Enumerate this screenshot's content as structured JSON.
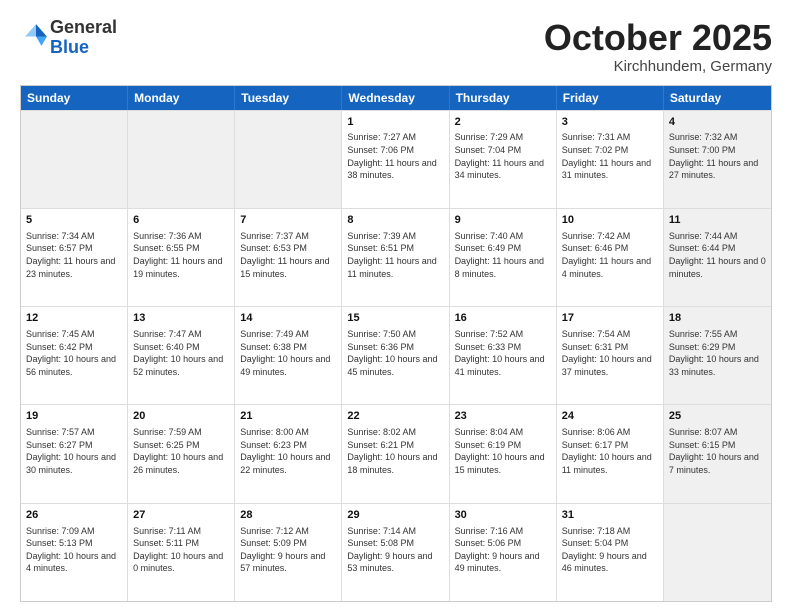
{
  "header": {
    "logo_general": "General",
    "logo_blue": "Blue",
    "title": "October 2025",
    "location": "Kirchhundem, Germany"
  },
  "days": [
    "Sunday",
    "Monday",
    "Tuesday",
    "Wednesday",
    "Thursday",
    "Friday",
    "Saturday"
  ],
  "weeks": [
    [
      {
        "day": "",
        "info": "",
        "shaded": true
      },
      {
        "day": "",
        "info": "",
        "shaded": true
      },
      {
        "day": "",
        "info": "",
        "shaded": true
      },
      {
        "day": "1",
        "info": "Sunrise: 7:27 AM\nSunset: 7:06 PM\nDaylight: 11 hours and 38 minutes."
      },
      {
        "day": "2",
        "info": "Sunrise: 7:29 AM\nSunset: 7:04 PM\nDaylight: 11 hours and 34 minutes."
      },
      {
        "day": "3",
        "info": "Sunrise: 7:31 AM\nSunset: 7:02 PM\nDaylight: 11 hours and 31 minutes."
      },
      {
        "day": "4",
        "info": "Sunrise: 7:32 AM\nSunset: 7:00 PM\nDaylight: 11 hours and 27 minutes.",
        "shaded": true
      }
    ],
    [
      {
        "day": "5",
        "info": "Sunrise: 7:34 AM\nSunset: 6:57 PM\nDaylight: 11 hours and 23 minutes."
      },
      {
        "day": "6",
        "info": "Sunrise: 7:36 AM\nSunset: 6:55 PM\nDaylight: 11 hours and 19 minutes."
      },
      {
        "day": "7",
        "info": "Sunrise: 7:37 AM\nSunset: 6:53 PM\nDaylight: 11 hours and 15 minutes."
      },
      {
        "day": "8",
        "info": "Sunrise: 7:39 AM\nSunset: 6:51 PM\nDaylight: 11 hours and 11 minutes."
      },
      {
        "day": "9",
        "info": "Sunrise: 7:40 AM\nSunset: 6:49 PM\nDaylight: 11 hours and 8 minutes."
      },
      {
        "day": "10",
        "info": "Sunrise: 7:42 AM\nSunset: 6:46 PM\nDaylight: 11 hours and 4 minutes."
      },
      {
        "day": "11",
        "info": "Sunrise: 7:44 AM\nSunset: 6:44 PM\nDaylight: 11 hours and 0 minutes.",
        "shaded": true
      }
    ],
    [
      {
        "day": "12",
        "info": "Sunrise: 7:45 AM\nSunset: 6:42 PM\nDaylight: 10 hours and 56 minutes."
      },
      {
        "day": "13",
        "info": "Sunrise: 7:47 AM\nSunset: 6:40 PM\nDaylight: 10 hours and 52 minutes."
      },
      {
        "day": "14",
        "info": "Sunrise: 7:49 AM\nSunset: 6:38 PM\nDaylight: 10 hours and 49 minutes."
      },
      {
        "day": "15",
        "info": "Sunrise: 7:50 AM\nSunset: 6:36 PM\nDaylight: 10 hours and 45 minutes."
      },
      {
        "day": "16",
        "info": "Sunrise: 7:52 AM\nSunset: 6:33 PM\nDaylight: 10 hours and 41 minutes."
      },
      {
        "day": "17",
        "info": "Sunrise: 7:54 AM\nSunset: 6:31 PM\nDaylight: 10 hours and 37 minutes."
      },
      {
        "day": "18",
        "info": "Sunrise: 7:55 AM\nSunset: 6:29 PM\nDaylight: 10 hours and 33 minutes.",
        "shaded": true
      }
    ],
    [
      {
        "day": "19",
        "info": "Sunrise: 7:57 AM\nSunset: 6:27 PM\nDaylight: 10 hours and 30 minutes."
      },
      {
        "day": "20",
        "info": "Sunrise: 7:59 AM\nSunset: 6:25 PM\nDaylight: 10 hours and 26 minutes."
      },
      {
        "day": "21",
        "info": "Sunrise: 8:00 AM\nSunset: 6:23 PM\nDaylight: 10 hours and 22 minutes."
      },
      {
        "day": "22",
        "info": "Sunrise: 8:02 AM\nSunset: 6:21 PM\nDaylight: 10 hours and 18 minutes."
      },
      {
        "day": "23",
        "info": "Sunrise: 8:04 AM\nSunset: 6:19 PM\nDaylight: 10 hours and 15 minutes."
      },
      {
        "day": "24",
        "info": "Sunrise: 8:06 AM\nSunset: 6:17 PM\nDaylight: 10 hours and 11 minutes."
      },
      {
        "day": "25",
        "info": "Sunrise: 8:07 AM\nSunset: 6:15 PM\nDaylight: 10 hours and 7 minutes.",
        "shaded": true
      }
    ],
    [
      {
        "day": "26",
        "info": "Sunrise: 7:09 AM\nSunset: 5:13 PM\nDaylight: 10 hours and 4 minutes."
      },
      {
        "day": "27",
        "info": "Sunrise: 7:11 AM\nSunset: 5:11 PM\nDaylight: 10 hours and 0 minutes."
      },
      {
        "day": "28",
        "info": "Sunrise: 7:12 AM\nSunset: 5:09 PM\nDaylight: 9 hours and 57 minutes."
      },
      {
        "day": "29",
        "info": "Sunrise: 7:14 AM\nSunset: 5:08 PM\nDaylight: 9 hours and 53 minutes."
      },
      {
        "day": "30",
        "info": "Sunrise: 7:16 AM\nSunset: 5:06 PM\nDaylight: 9 hours and 49 minutes."
      },
      {
        "day": "31",
        "info": "Sunrise: 7:18 AM\nSunset: 5:04 PM\nDaylight: 9 hours and 46 minutes."
      },
      {
        "day": "",
        "info": "",
        "shaded": true
      }
    ]
  ]
}
